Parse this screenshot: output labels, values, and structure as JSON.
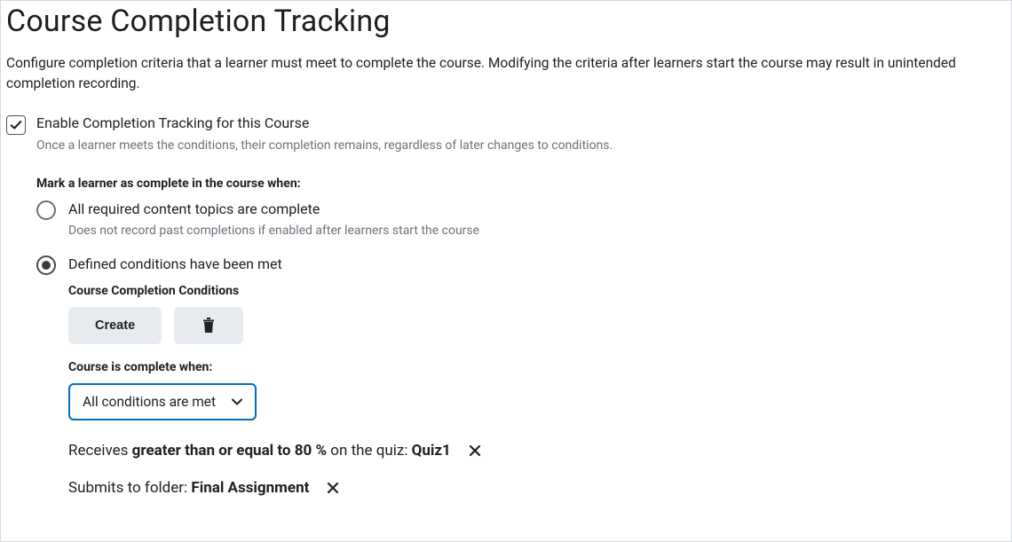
{
  "page": {
    "title": "Course Completion Tracking",
    "intro": "Configure completion criteria that a learner must meet to complete the course. Modifying the criteria after learners start the course may result in unintended completion recording."
  },
  "enable": {
    "checked": true,
    "label": "Enable Completion Tracking for this Course",
    "help": "Once a learner meets the conditions, their completion remains, regardless of later changes to conditions."
  },
  "criteria": {
    "heading": "Mark a learner as complete in the course when:",
    "options": [
      {
        "id": "all-topics",
        "label": "All required content topics are complete",
        "help": "Does not record past completions if enabled after learners start the course",
        "selected": false
      },
      {
        "id": "defined-conditions",
        "label": "Defined conditions have been met",
        "help": "",
        "selected": true
      }
    ]
  },
  "conditions": {
    "heading": "Course Completion Conditions",
    "create_label": "Create",
    "delete_icon": "trash-icon",
    "rule_label": "Course is complete when:",
    "rule_selected": "All conditions are met",
    "items": [
      {
        "prefix": "Receives ",
        "bold1": "greater than or equal to 80 %",
        "mid": " on the quiz: ",
        "bold2": "Quiz1"
      },
      {
        "prefix": "Submits to folder: ",
        "bold1": "Final Assignment",
        "mid": "",
        "bold2": ""
      }
    ]
  }
}
